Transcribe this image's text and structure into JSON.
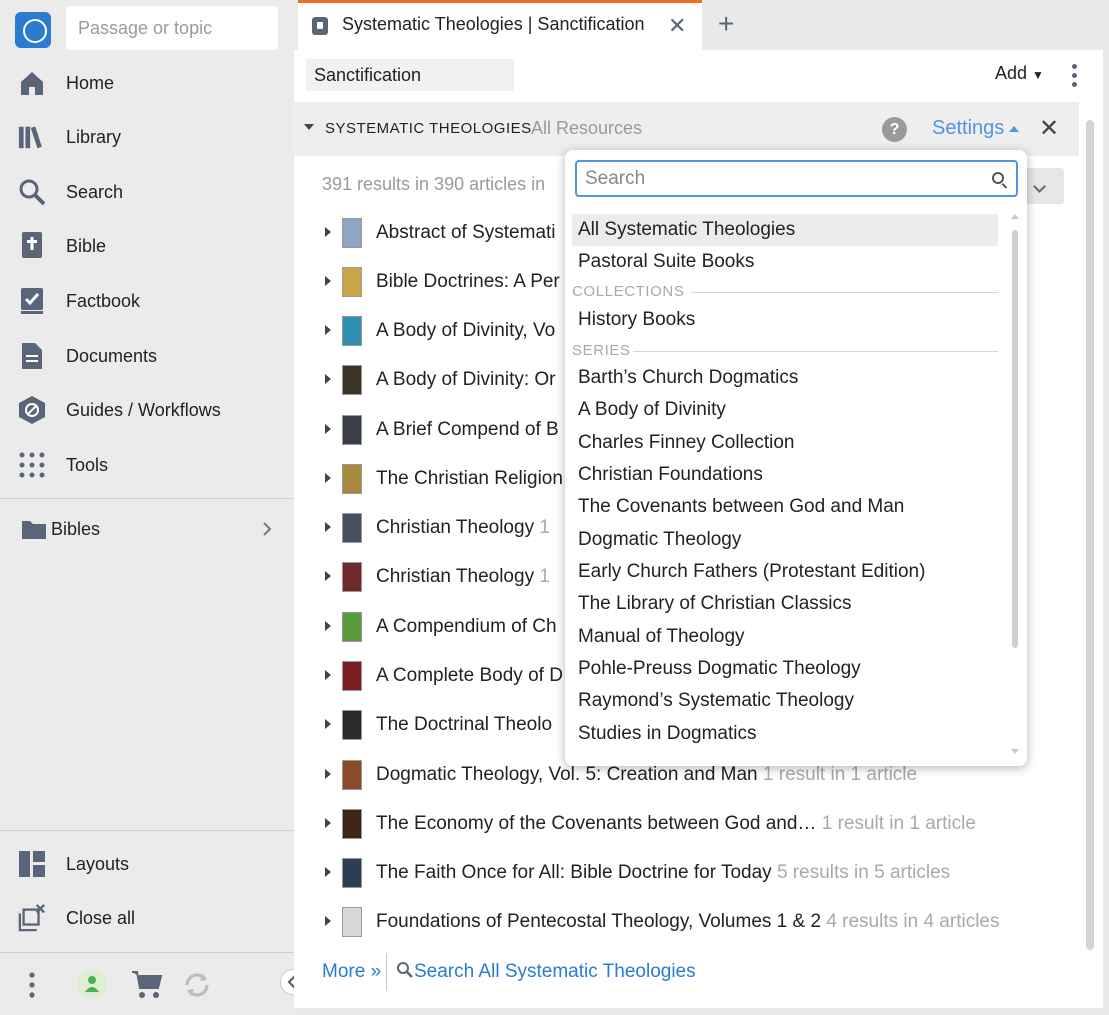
{
  "sidebar": {
    "search_placeholder": "Passage or topic",
    "nav": [
      {
        "label": "Home",
        "icon": "home-icon"
      },
      {
        "label": "Library",
        "icon": "library-icon"
      },
      {
        "label": "Search",
        "icon": "search-icon"
      },
      {
        "label": "Bible",
        "icon": "bible-icon"
      },
      {
        "label": "Factbook",
        "icon": "factbook-icon"
      },
      {
        "label": "Documents",
        "icon": "documents-icon"
      },
      {
        "label": "Guides / Workflows",
        "icon": "guides-icon"
      },
      {
        "label": "Tools",
        "icon": "tools-icon"
      }
    ],
    "folder": {
      "label": "Bibles",
      "icon": "folder-icon"
    },
    "bottom": [
      {
        "label": "Layouts",
        "icon": "layouts-icon"
      },
      {
        "label": "Close all",
        "icon": "close-all-icon"
      }
    ]
  },
  "tab": {
    "title": "Systematic Theologies | Sanctification"
  },
  "panel": {
    "query": "Sanctification",
    "add_label": "Add",
    "section_title": "SYSTEMATIC THEOLOGIES",
    "section_scope": "All Resources",
    "help_label": "?",
    "settings_label": "Settings",
    "results_summary": "391 results in 390 articles in",
    "results": [
      {
        "title": "Abstract of Systemati",
        "count": "",
        "cover": "#8fa6c2"
      },
      {
        "title": "Bible Doctrines: A Per",
        "count": "",
        "cover": "#c9a64a"
      },
      {
        "title": "A Body of Divinity, Vo",
        "count": "",
        "cover": "#2f8fb0"
      },
      {
        "title": "A Body of Divinity: Or",
        "count": "",
        "cover": "#3b3326"
      },
      {
        "title": "A Brief Compend of B",
        "count": "",
        "cover": "#3a3f4a"
      },
      {
        "title": "The Christian Religion",
        "count": "",
        "cover": "#a88a3e"
      },
      {
        "title": "Christian Theology",
        "count": "1",
        "cover": "#4a4f60"
      },
      {
        "title": "Christian Theology",
        "count": "1",
        "cover": "#6d2b2b"
      },
      {
        "title": "A Compendium of Ch",
        "count": "",
        "cover": "#5a9a3a"
      },
      {
        "title": "A Complete Body of D",
        "count": "",
        "cover": "#7a2020"
      },
      {
        "title": "The Doctrinal Theolo",
        "count": "",
        "cover": "#2a2a2a"
      },
      {
        "title": "Dogmatic Theology, Vol. 5: Creation and Man",
        "count": "1 result in 1 article",
        "cover": "#8b4a2a"
      },
      {
        "title": "The Economy of the Covenants between God and…",
        "count": "1 result in 1 article",
        "cover": "#3b2418"
      },
      {
        "title": "The Faith Once for All: Bible Doctrine for Today",
        "count": "5 results in 5 articles",
        "cover": "#2c3e50"
      },
      {
        "title": "Foundations of Pentecostal Theology, Volumes 1 & 2",
        "count": "4 results in 4 articles",
        "cover": "#d8d8d8"
      }
    ],
    "more_label": "More »",
    "search_all_label": "Search All Systematic Theologies"
  },
  "dropdown": {
    "search_placeholder": "Search",
    "top_options": [
      "All Systematic Theologies",
      "Pastoral Suite Books"
    ],
    "collections_header": "COLLECTIONS",
    "collections": [
      "History Books"
    ],
    "series_header": "SERIES",
    "series": [
      "Barth’s Church Dogmatics",
      "A Body of Divinity",
      "Charles Finney Collection",
      "Christian Foundations",
      "The Covenants between God and Man",
      "Dogmatic Theology",
      "Early Church Fathers (Protestant Edition)",
      "The Library of Christian Classics",
      "Manual of Theology",
      "Pohle-Preuss Dogmatic Theology",
      "Raymond’s Systematic Theology",
      "Studies in Dogmatics"
    ]
  },
  "colors": {
    "accent": "#f36b21",
    "link": "#2a7bd1",
    "settings": "#4f96dd",
    "icon": "#5a6579"
  }
}
